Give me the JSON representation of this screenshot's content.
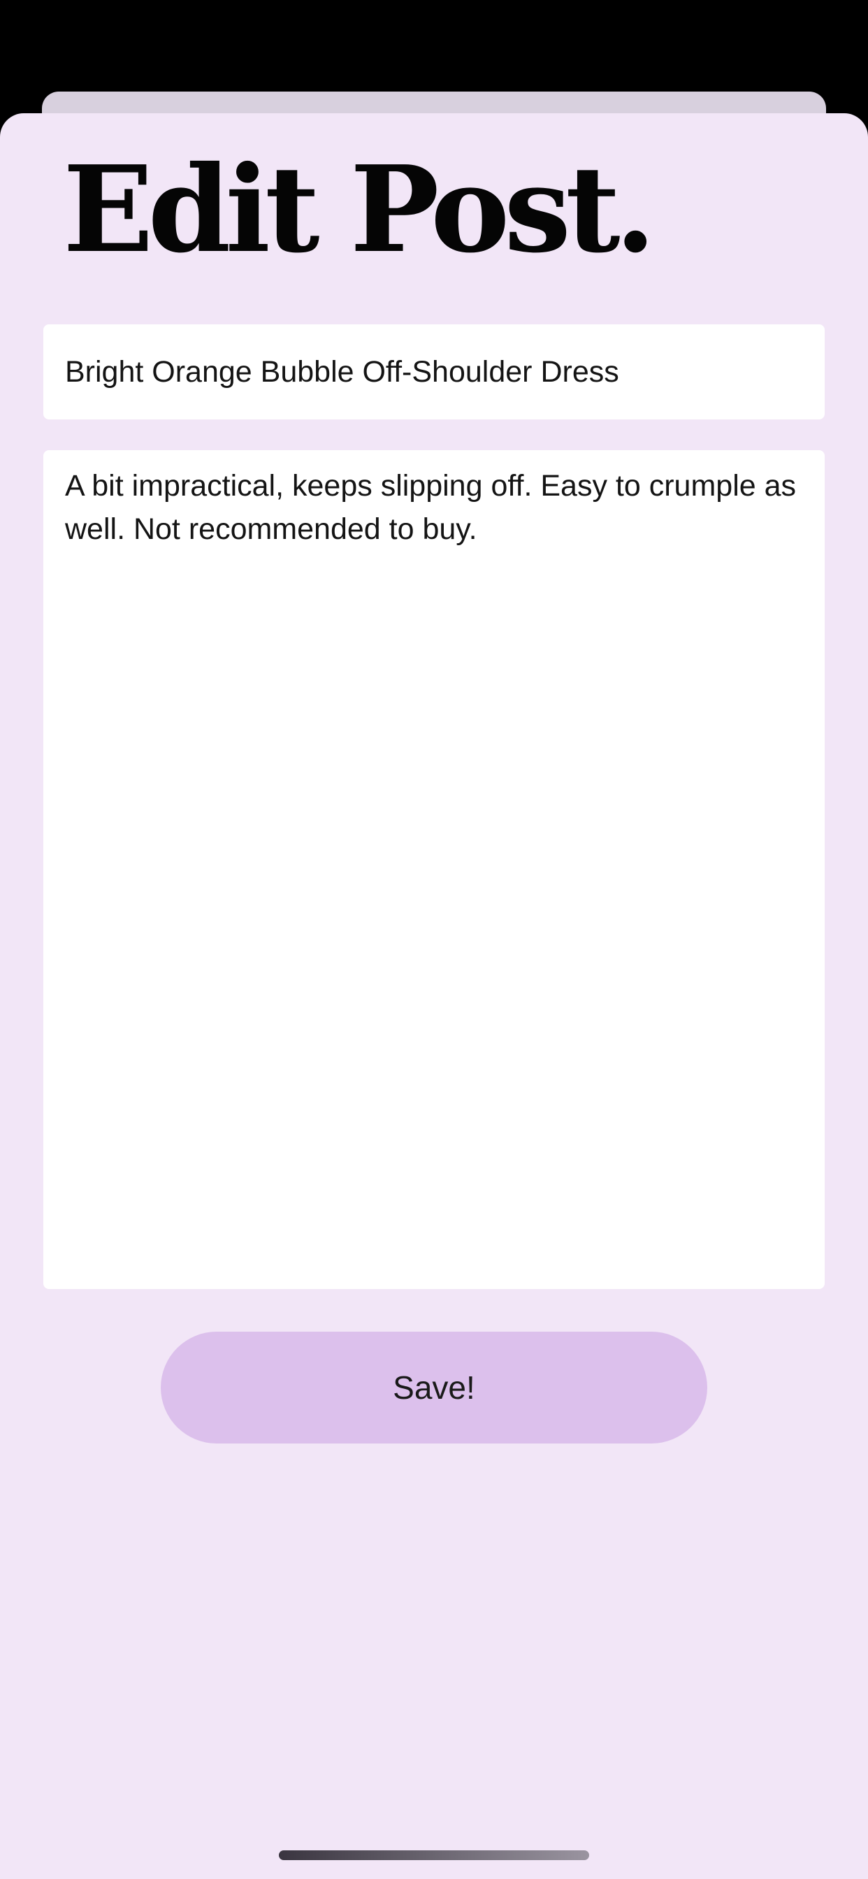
{
  "header": {
    "title": "Edit Post."
  },
  "form": {
    "title_value": "Bright Orange Bubble Off-Shoulder Dress",
    "body_value": "A bit impractical, keeps slipping off. Easy to crumple as well. Not recommended to buy.",
    "save_label": "Save!"
  },
  "colors": {
    "background": "#f2e6f7",
    "button": "#dcc0ec",
    "field": "#ffffff"
  }
}
